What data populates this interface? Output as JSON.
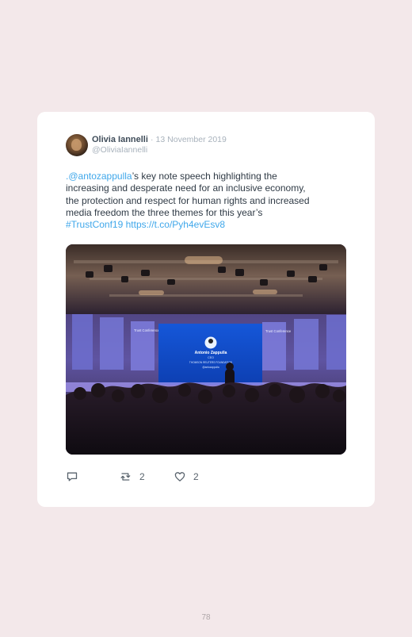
{
  "tweet": {
    "author": {
      "name": "Olivia Iannelli",
      "separator": "·",
      "date": "13 November 2019",
      "handle": "@OliviaIannelli"
    },
    "text": {
      "prefix": ".",
      "mention": "@antozappulla",
      "line1": "’s key note speech highlighting the",
      "line2": "increasing and desperate need for an inclusive economy,",
      "line3": "the protection and respect for human rights and increased",
      "line4": "media freedom the three themes for this year’s",
      "hashtag": "#TrustConf19",
      "url": "https://t.co/Pyh4evEsv8"
    },
    "media": {
      "screen_text": {
        "title": "Antonio Zappulla",
        "subtitle": "CEO",
        "caption": "THOMSON REUTERS FOUNDATION",
        "handle": "@antozappulla"
      },
      "side_screens": {
        "left": "Trust Conference",
        "right": "Trust Conference"
      }
    },
    "actions": {
      "retweets": "2",
      "likes": "2"
    }
  },
  "page": {
    "number": "78"
  }
}
